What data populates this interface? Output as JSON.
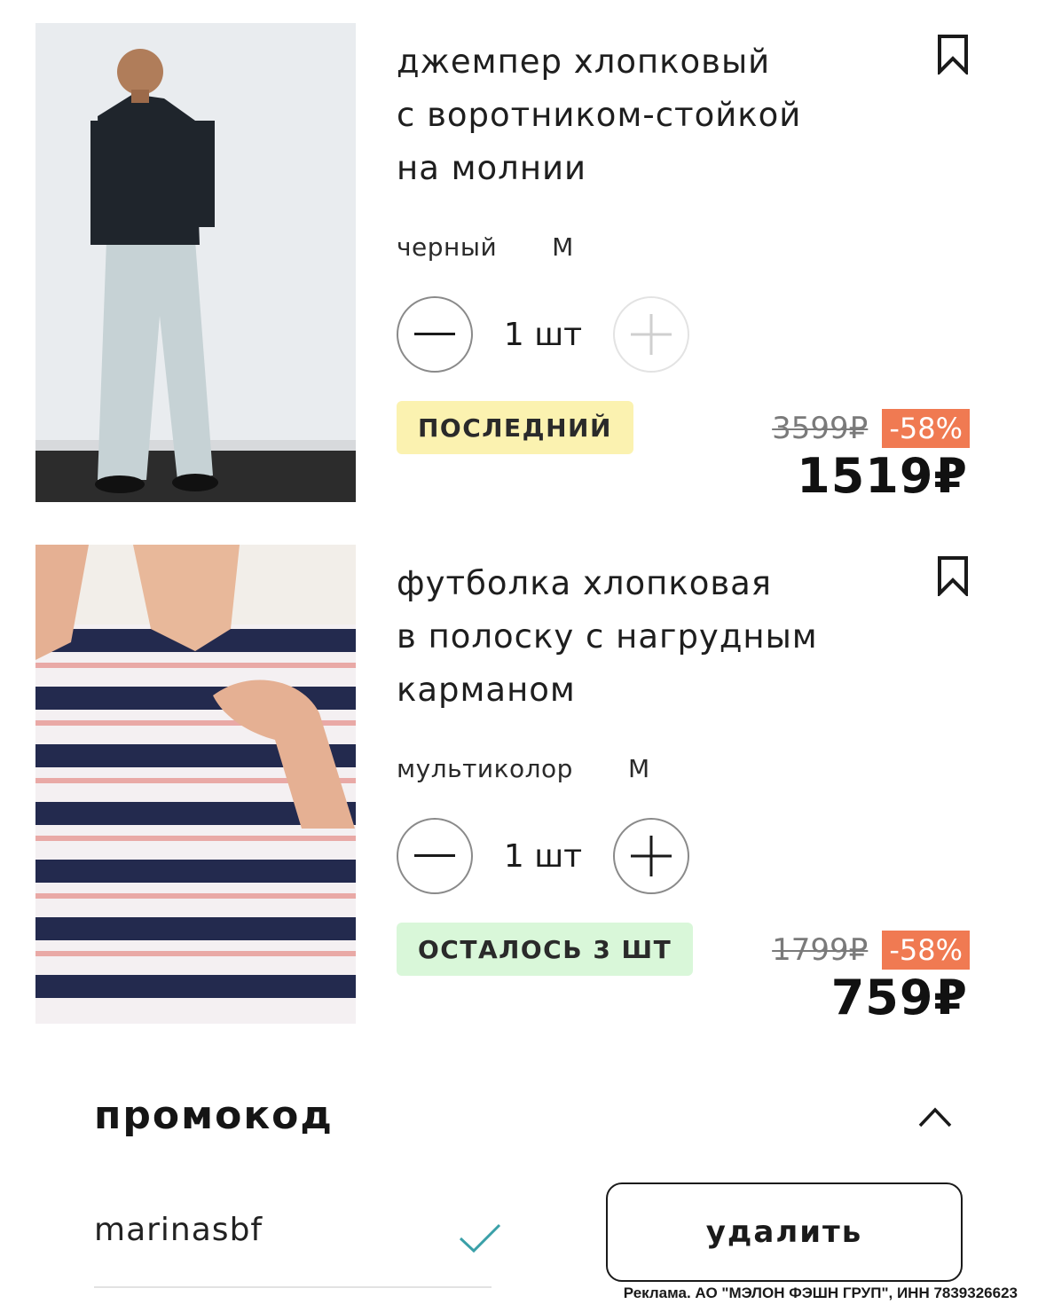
{
  "cart": {
    "items": [
      {
        "title_lines": [
          "джемпер хлопковый",
          "с воротником-стойкой",
          "на молнии"
        ],
        "color": "черный",
        "size": "M",
        "quantity": "1 шт",
        "badge": "ПОСЛЕДНИЙ",
        "old_price": "3599₽",
        "discount": "-58%",
        "price": "1519₽",
        "plus_enabled": false
      },
      {
        "title_lines": [
          "футболка хлопковая",
          "в полоску с нагрудным",
          "карманом"
        ],
        "color": "мультиколор",
        "size": "M",
        "quantity": "1 шт",
        "badge": "ОСТАЛОСЬ 3 ШТ",
        "old_price": "1799₽",
        "discount": "-58%",
        "price": "759₽",
        "plus_enabled": true
      }
    ]
  },
  "promo": {
    "title": "промокод",
    "code": "marinasbf",
    "remove_label": "удалить"
  },
  "ad_text": "Реклама. АО \"МЭЛОН ФЭШН ГРУП\", ИНН 7839326623",
  "colors": {
    "badge_last": "#fbf2b0",
    "badge_left": "#d9f7d9",
    "discount": "#f07a52",
    "check": "#3aa0a8"
  },
  "icons": [
    "bookmark-icon",
    "minus-icon",
    "plus-icon",
    "chevron-up-icon",
    "check-icon"
  ]
}
